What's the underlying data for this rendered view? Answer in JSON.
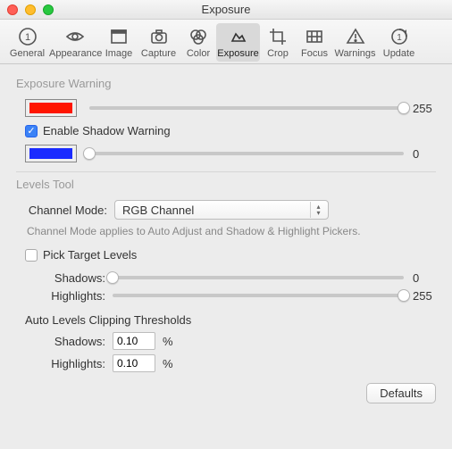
{
  "window": {
    "title": "Exposure"
  },
  "toolbar": {
    "items": [
      {
        "label": "General"
      },
      {
        "label": "Appearance"
      },
      {
        "label": "Image"
      },
      {
        "label": "Capture"
      },
      {
        "label": "Color"
      },
      {
        "label": "Exposure"
      },
      {
        "label": "Crop"
      },
      {
        "label": "Focus"
      },
      {
        "label": "Warnings"
      },
      {
        "label": "Update"
      }
    ],
    "active_index": 5
  },
  "exposure_warning": {
    "section_label": "Exposure Warning",
    "highlight_swatch": "#ff1500",
    "highlight_value": "255",
    "highlight_pos_pct": 100,
    "enable_shadow_label": "Enable Shadow Warning",
    "enable_shadow_checked": true,
    "shadow_swatch": "#1a2bff",
    "shadow_value": "0",
    "shadow_pos_pct": 0
  },
  "levels_tool": {
    "section_label": "Levels Tool",
    "channel_mode_label": "Channel Mode:",
    "channel_mode_value": "RGB Channel",
    "hint": "Channel Mode applies to Auto Adjust and Shadow & Highlight Pickers.",
    "pick_target_label": "Pick Target Levels",
    "pick_target_checked": false,
    "shadows_label": "Shadows:",
    "shadows_value": "0",
    "shadows_pos_pct": 0,
    "highlights_label": "Highlights:",
    "highlights_value": "255",
    "highlights_pos_pct": 100,
    "auto_levels_heading": "Auto Levels Clipping Thresholds",
    "auto_shadows_label": "Shadows:",
    "auto_shadows_value": "0.10",
    "auto_highlights_label": "Highlights:",
    "auto_highlights_value": "0.10",
    "percent": "%"
  },
  "buttons": {
    "defaults": "Defaults"
  }
}
